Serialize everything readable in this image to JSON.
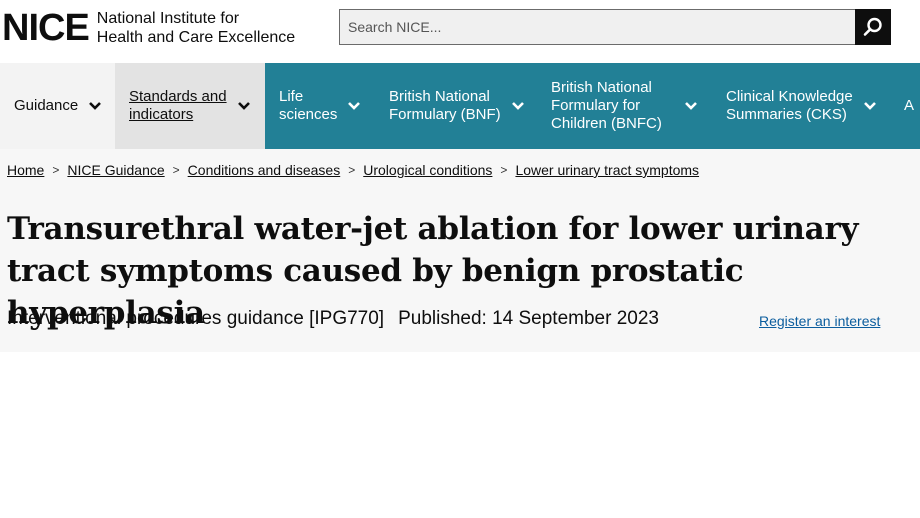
{
  "header": {
    "logo_mark": "NICE",
    "logo_line1": "National Institute for",
    "logo_line2": "Health and Care Excellence",
    "search_placeholder": "Search NICE...",
    "search_icon": "search-icon"
  },
  "nav": {
    "items": [
      {
        "line1": "Guidance",
        "line2": ""
      },
      {
        "line1": "Standards and",
        "line2": "indicators"
      },
      {
        "line1": "Life",
        "line2": "sciences"
      },
      {
        "line1": "British National",
        "line2": "Formulary (BNF)"
      },
      {
        "line1": "British National",
        "line2": "Formulary for",
        "line3": "Children (BNFC)"
      },
      {
        "line1": "Clinical Knowledge",
        "line2": "Summaries (CKS)"
      },
      {
        "line1": "A",
        "line2": ""
      }
    ],
    "chevron_icon": "chevron-down-icon"
  },
  "breadcrumb": [
    "Home",
    "NICE Guidance",
    "Conditions and diseases",
    "Urological conditions",
    "Lower urinary tract symptoms"
  ],
  "page": {
    "title": "Transurethral water-jet ablation for lower urinary tract symptoms caused by benign prostatic hyperplasia",
    "guidance_type": "Interventional procedures guidance [IPG770]",
    "published": "Published: 14 September 2023",
    "register_link": "Register an interest"
  },
  "colors": {
    "nav_bg": "#228096",
    "link": "#0b5d9e"
  }
}
